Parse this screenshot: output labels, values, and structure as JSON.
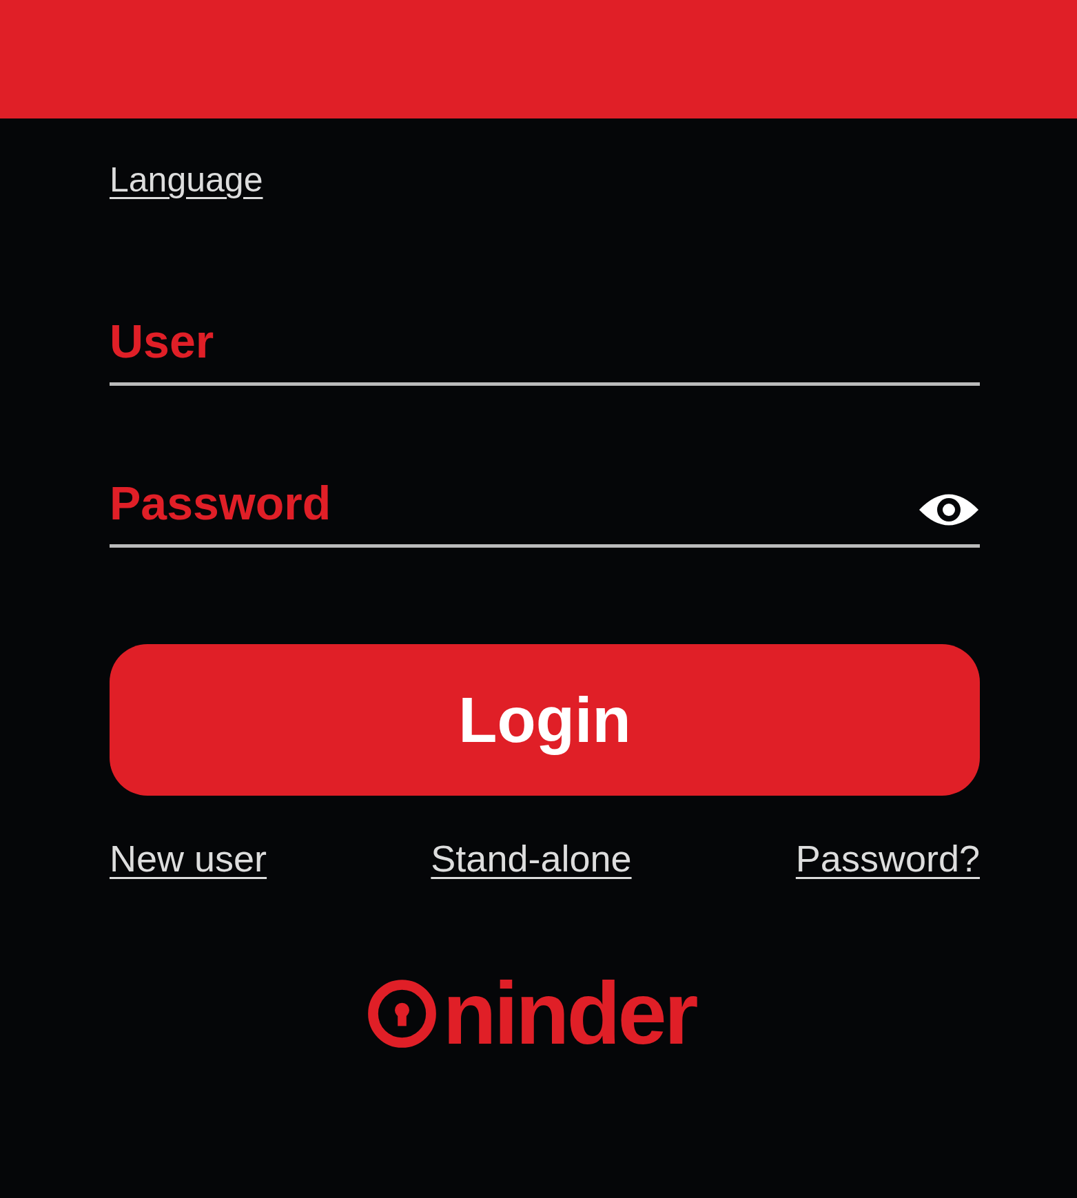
{
  "language_link": "Language",
  "fields": [
    {
      "placeholder": "User",
      "kind": "text"
    },
    {
      "placeholder": "Password",
      "kind": "password"
    }
  ],
  "login_button": "Login",
  "links": [
    "New user",
    "Stand-alone",
    "Password?"
  ],
  "logo": {
    "text": "ninder"
  }
}
